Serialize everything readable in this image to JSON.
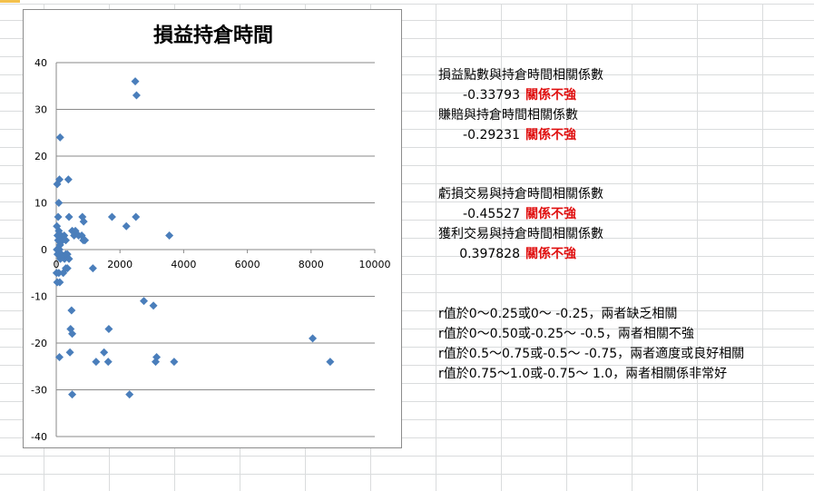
{
  "chart_data": {
    "type": "scatter",
    "title": "損益持倉時間",
    "xlabel": "",
    "ylabel": "",
    "xlim": [
      0,
      10000
    ],
    "ylim": [
      -40,
      40
    ],
    "x_ticks": [
      "0",
      "2000",
      "4000",
      "6000",
      "8000",
      "10000"
    ],
    "y_ticks": [
      "40",
      "30",
      "20",
      "10",
      "0",
      "-10",
      "-20",
      "-30",
      "-40"
    ],
    "grid": "horizontal",
    "marker": "diamond",
    "color": "#4a7ebb",
    "points": [
      [
        30,
        14
      ],
      [
        80,
        10
      ],
      [
        100,
        15
      ],
      [
        60,
        7
      ],
      [
        120,
        24
      ],
      [
        380,
        15
      ],
      [
        400,
        7
      ],
      [
        820,
        7
      ],
      [
        860,
        6
      ],
      [
        1750,
        7
      ],
      [
        2500,
        7
      ],
      [
        2200,
        5
      ],
      [
        2480,
        36
      ],
      [
        2520,
        33
      ],
      [
        3550,
        3
      ],
      [
        20,
        5
      ],
      [
        40,
        3
      ],
      [
        60,
        2
      ],
      [
        80,
        4
      ],
      [
        120,
        1
      ],
      [
        150,
        3
      ],
      [
        200,
        2
      ],
      [
        250,
        3
      ],
      [
        300,
        2
      ],
      [
        500,
        4
      ],
      [
        560,
        3
      ],
      [
        600,
        4
      ],
      [
        700,
        3
      ],
      [
        800,
        3
      ],
      [
        850,
        2
      ],
      [
        900,
        2
      ],
      [
        20,
        0
      ],
      [
        40,
        -1
      ],
      [
        60,
        -1
      ],
      [
        100,
        0
      ],
      [
        130,
        -2
      ],
      [
        160,
        -1
      ],
      [
        260,
        -2
      ],
      [
        300,
        -1
      ],
      [
        350,
        -1
      ],
      [
        400,
        -2
      ],
      [
        10,
        -5
      ],
      [
        30,
        -7
      ],
      [
        80,
        -5
      ],
      [
        110,
        -7
      ],
      [
        220,
        -5
      ],
      [
        300,
        -4
      ],
      [
        350,
        -4
      ],
      [
        1150,
        -4
      ],
      [
        480,
        -13
      ],
      [
        450,
        -17
      ],
      [
        500,
        -18
      ],
      [
        1650,
        -17
      ],
      [
        2750,
        -11
      ],
      [
        3050,
        -12
      ],
      [
        100,
        -23
      ],
      [
        430,
        -22
      ],
      [
        1250,
        -24
      ],
      [
        1500,
        -22
      ],
      [
        1630,
        -24
      ],
      [
        3120,
        -24
      ],
      [
        3150,
        -23
      ],
      [
        3700,
        -24
      ],
      [
        8050,
        -19
      ],
      [
        8600,
        -24
      ],
      [
        2300,
        -31
      ],
      [
        500,
        -31
      ]
    ]
  },
  "notes": [
    {
      "label": "損益點數與持倉時間相關係數",
      "value": "-0.33793",
      "verdict": "關係不強"
    },
    {
      "label": "賺賠與持倉時間相關係數",
      "value": "-0.29231",
      "verdict": "關係不強"
    },
    {
      "label": "虧損交易與持倉時間相關係數",
      "value": "-0.45527",
      "verdict": "關係不強"
    },
    {
      "label": "獲利交易與持倉時間相關係數",
      "value": "0.397828",
      "verdict": "關係不強"
    }
  ],
  "rules": [
    "r值於0～0.25或0～ -0.25，兩者缺乏相關",
    "r值於0～0.50或-0.25～ -0.5，兩者相關不強",
    "r值於0.5～0.75或-0.5～ -0.75，兩者適度或良好相關",
    "r值於0.75～1.0或-0.75～ 1.0，兩者相關係非常好"
  ]
}
